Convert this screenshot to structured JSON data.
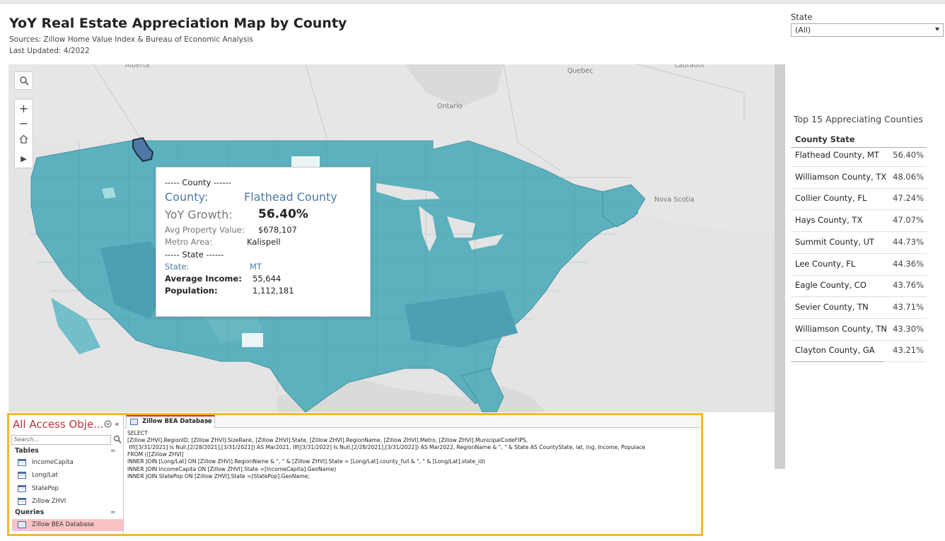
{
  "header": {
    "title": "YoY Real Estate Appreciation Map by County",
    "sources": "Sources: Zillow Home Value Index & Bureau of Economic Analysis",
    "last_updated": "Last Updated: 4/2022"
  },
  "filter": {
    "label": "State",
    "value": "(All)"
  },
  "map": {
    "labels": [
      "Quebec",
      "Ontario",
      "Nova Scotia",
      "Alberta",
      "Labrador"
    ],
    "colors": {
      "land": "#5db0bd",
      "light": "#8fd0d3",
      "dark": "#3f8fa3",
      "border": "#2f6e80",
      "background": "#e4e4e4",
      "ocean": "#d8d8d8"
    },
    "tools": {
      "search_icon": "search-icon",
      "zoom_in": "+",
      "zoom_out": "−",
      "home_icon": "home-icon",
      "play_icon": "▶"
    },
    "tooltip": {
      "county_section": "----- County ------",
      "county_label": "County:",
      "county_value": "Flathead County",
      "growth_label": "YoY Growth:",
      "growth_value": "56.40%",
      "avg_value_label": "Avg Property Value:",
      "avg_value_value": "$678,107",
      "metro_label": "Metro Area:",
      "metro_value": "Kalispell",
      "state_section": "----- State ------",
      "state_label": "State:",
      "state_value": "MT",
      "income_label": "Average Income:",
      "income_value": "55,644",
      "population_label": "Population:",
      "population_value": "1,112,181"
    }
  },
  "top15": {
    "title": "Top 15 Appreciating Counties",
    "header": "County State",
    "rows": [
      {
        "county": "Flathead County, MT",
        "pct": "56.40%"
      },
      {
        "county": "Williamson County, TX",
        "pct": "48.06%"
      },
      {
        "county": "Collier County, FL",
        "pct": "47.24%"
      },
      {
        "county": "Hays County, TX",
        "pct": "47.07%"
      },
      {
        "county": "Summit County, UT",
        "pct": "44.73%"
      },
      {
        "county": "Lee County, FL",
        "pct": "44.36%"
      },
      {
        "county": "Eagle County, CO",
        "pct": "43.76%"
      },
      {
        "county": "Sevier County, TN",
        "pct": "43.71%"
      },
      {
        "county": "Williamson County, TN",
        "pct": "43.30%"
      },
      {
        "county": "Clayton County, GA",
        "pct": "43.21%"
      }
    ]
  },
  "access": {
    "nav_title": "All Access Obje...",
    "search_placeholder": "Search...",
    "tables_label": "Tables",
    "tables": [
      "IncomeCapita",
      "Long/Lat",
      "StatePop",
      "Zillow ZHVI"
    ],
    "queries_label": "Queries",
    "queries": [
      "Zillow BEA Database"
    ],
    "tab_label": "Zillow BEA Database",
    "tab_close": "✕",
    "sql_lines": [
      "SELECT",
      "[Zillow ZHVI].RegionID, [Zillow ZHVI].SizeRank, [Zillow ZHVI].State, [Zillow ZHVI].RegionName, [Zillow ZHVI].Metro, [Zillow ZHVI].MunicipalCodeFIPS,",
      " IIf([3/31/2021] Is Null,[2/28/2021],[3/31/2021]) AS Mar2021, IIf([3/31/2022] Is Null,[2/28/2021],[3/31/2022]) AS Mar2022, RegionName & \", \" & State AS CountyState, lat, lng, Income, Populace",
      "FROM (([Zillow ZHVI]",
      "INNER JOIN [Long/Lat] ON [Zillow ZHVI].RegionName & \", \" & [Zillow ZHVI].State = [Long/Lat].county_full & \", \" & [Long/Lat].state_id)",
      "INNER JOIN IncomeCapita ON [Zillow ZHVI].State =[IncomeCapita].GeoName)",
      "INNER JOIN StatePop ON [Zillow ZHVI].State =[StatePop].GeoName;"
    ]
  }
}
